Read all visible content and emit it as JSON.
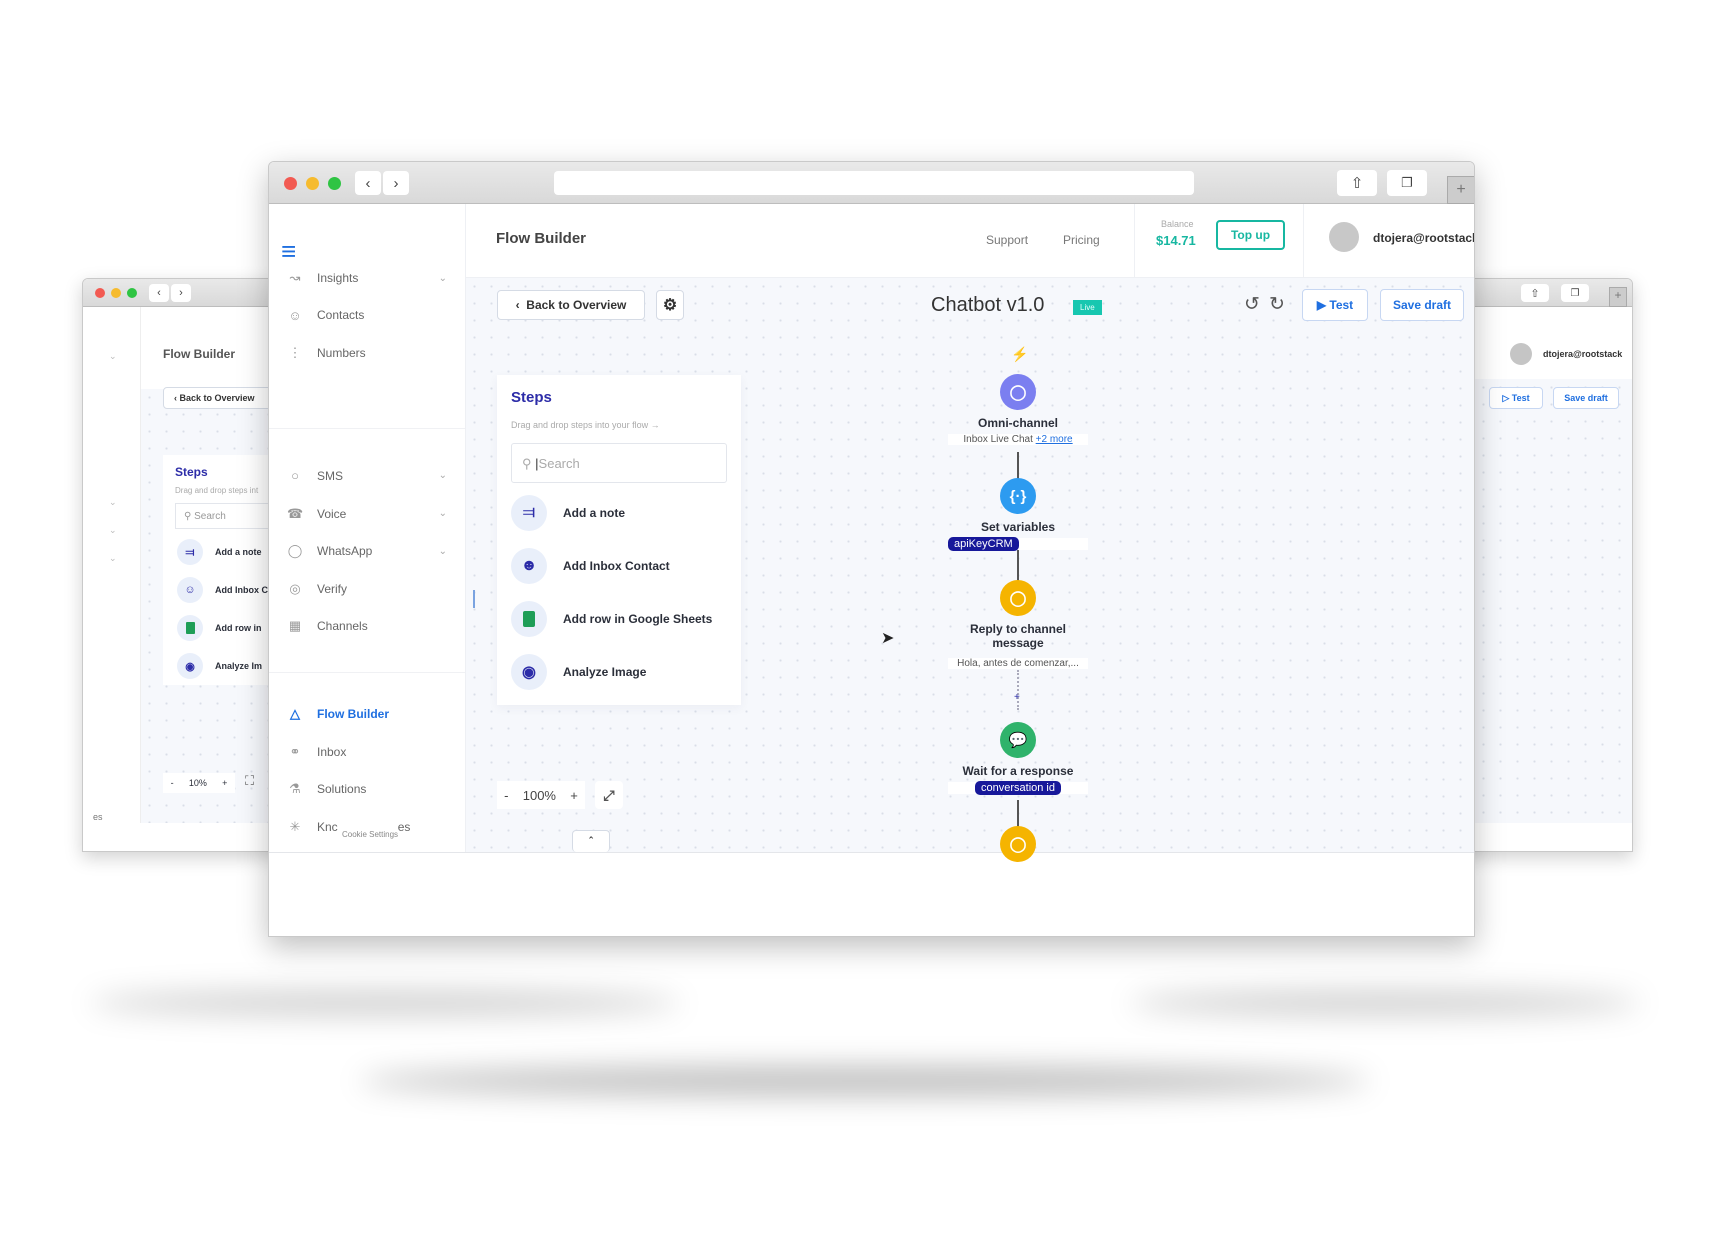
{
  "back_left": {
    "page_title": "Flow Builder",
    "back_button": "Back to Overview",
    "steps_title": "Steps",
    "steps_hint": "Drag and drop steps int",
    "search_placeholder": "Search",
    "steps": [
      "Add a note",
      "Add Inbox C",
      "Add row in",
      "Analyze Im"
    ],
    "zoom_level": "10%",
    "zoom_minus": "-",
    "zoom_plus": "+",
    "footer_fragment": "es"
  },
  "back_right": {
    "user": "dtojera@rootstack",
    "test_button": "Test",
    "save_button": "Save draft"
  },
  "main": {
    "header": {
      "title": "Flow Builder",
      "support": "Support",
      "pricing": "Pricing",
      "balance_label": "Balance",
      "balance_value": "$14.71",
      "topup": "Top up",
      "user": "dtojera@rootstack"
    },
    "sidebar": {
      "group1": [
        {
          "label": "Insights",
          "icon": "chart-icon",
          "chevron": true
        },
        {
          "label": "Contacts",
          "icon": "user-icon"
        },
        {
          "label": "Numbers",
          "icon": "dialpad-icon"
        }
      ],
      "group2": [
        {
          "label": "SMS",
          "icon": "sms-icon",
          "chevron": true
        },
        {
          "label": "Voice",
          "icon": "phone-icon",
          "chevron": true
        },
        {
          "label": "WhatsApp",
          "icon": "whatsapp-icon",
          "chevron": true
        },
        {
          "label": "Verify",
          "icon": "verify-icon"
        },
        {
          "label": "Channels",
          "icon": "channels-icon"
        }
      ],
      "group3": [
        {
          "label": "Flow Builder",
          "icon": "flow-icon",
          "active": true
        },
        {
          "label": "Inbox",
          "icon": "headset-icon"
        },
        {
          "label": "Solutions",
          "icon": "flask-icon"
        },
        {
          "label": "Knc",
          "icon": "nodes-icon"
        }
      ],
      "kn_suffix": "es",
      "cookie_settings": "Cookie Settings"
    },
    "toolbar": {
      "back_button": "Back to Overview",
      "flow_name": "Chatbot v1.0",
      "status_badge": "Live",
      "test_button": "Test",
      "save_button": "Save draft"
    },
    "steps_panel": {
      "title": "Steps",
      "hint": "Drag and drop steps into your flow →",
      "search_placeholder": "Search",
      "items": [
        {
          "label": "Add a note",
          "icon": "pin-icon"
        },
        {
          "label": "Add Inbox Contact",
          "icon": "add-user-icon"
        },
        {
          "label": "Add row in Google Sheets",
          "icon": "sheets-icon"
        },
        {
          "label": "Analyze Image",
          "icon": "eye-icon"
        }
      ]
    },
    "zoom": {
      "minus": "-",
      "level": "100%",
      "plus": "+"
    },
    "flow": [
      {
        "title": "Omni-channel",
        "sub": "Inbox Live Chat",
        "link": "+2 more",
        "color": "#7b7ff0"
      },
      {
        "title": "Set variables",
        "pill": "apiKeyCRM",
        "color": "#2d9bf0"
      },
      {
        "title": "Reply to channel message",
        "sub": "Hola, antes de comenzar,...",
        "color": "#f5b400"
      },
      {
        "title": "Wait for a response",
        "pill": "conversation id",
        "color": "#2fb36b"
      },
      {
        "color": "#f5b400"
      }
    ]
  },
  "colors": {
    "accent": "#1f6fe0",
    "teal": "#17b7a1",
    "navy": "#17189a",
    "steps_title": "#2c2ca8"
  }
}
